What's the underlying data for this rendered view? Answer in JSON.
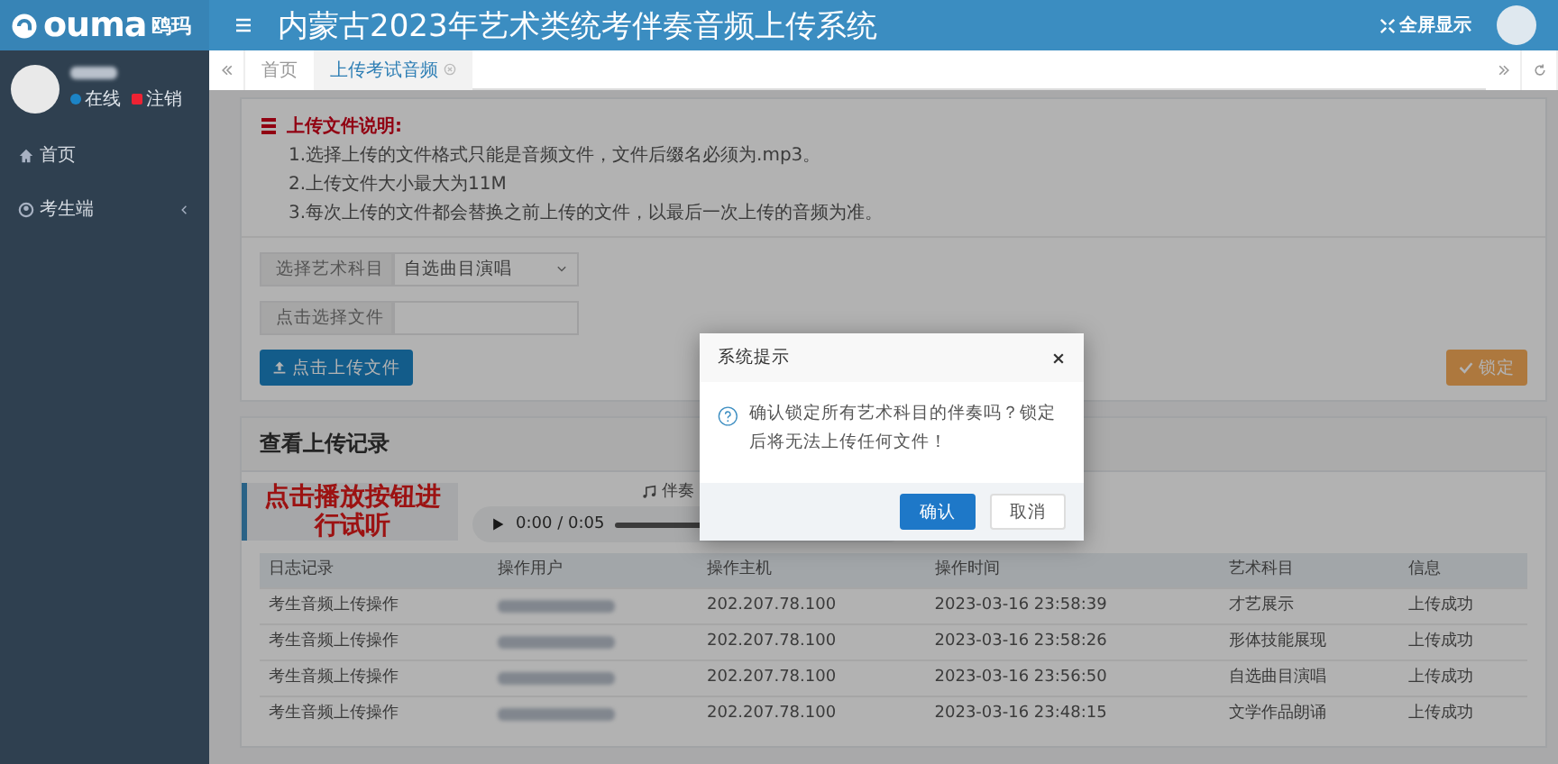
{
  "app": {
    "logo": "ouma",
    "logo_cn": "鸥玛",
    "title": "内蒙古2023年艺术类统考伴奏音频上传系统",
    "fullscreen": "全屏显示"
  },
  "sidebar": {
    "status": "在线",
    "logout": "注销",
    "menu": [
      {
        "label": "首页",
        "kind": "home",
        "expandable": false
      },
      {
        "label": "考生端",
        "kind": "user",
        "expandable": true
      }
    ]
  },
  "tabs": [
    {
      "label": "首页",
      "selected": false,
      "closable": false
    },
    {
      "label": "上传考试音频",
      "selected": true,
      "closable": true
    }
  ],
  "instructions": {
    "title": "上传文件说明:",
    "lines": [
      "1.选择上传的文件格式只能是音频文件，文件后缀名必须为.mp3。",
      "2.上传文件大小最大为11M",
      "3.每次上传的文件都会替换之前上传的文件，以最后一次上传的音频为准。"
    ]
  },
  "form": {
    "subject_label": "选择艺术科目",
    "subject_value": "自选曲目演唱",
    "file_label": "点击选择文件",
    "upload_button": "点击上传文件",
    "lock_button": "锁定"
  },
  "records": {
    "title": "查看上传记录",
    "hint": "点击播放按钮进行试听",
    "player": {
      "time": "0:00 / 0:05",
      "caption": "伴奏"
    },
    "columns": [
      "日志记录",
      "操作用户",
      "操作主机",
      "操作时间",
      "艺术科目",
      "信息"
    ],
    "rows": [
      {
        "log": "考生音频上传操作",
        "host": "202.207.78.100",
        "time": "2023-03-16 23:58:39",
        "subject": "才艺展示",
        "info": "上传成功"
      },
      {
        "log": "考生音频上传操作",
        "host": "202.207.78.100",
        "time": "2023-03-16 23:58:26",
        "subject": "形体技能展现",
        "info": "上传成功"
      },
      {
        "log": "考生音频上传操作",
        "host": "202.207.78.100",
        "time": "2023-03-16 23:56:50",
        "subject": "自选曲目演唱",
        "info": "上传成功"
      },
      {
        "log": "考生音频上传操作",
        "host": "202.207.78.100",
        "time": "2023-03-16 23:48:15",
        "subject": "文学作品朗诵",
        "info": "上传成功"
      }
    ]
  },
  "dialog": {
    "title": "系统提示",
    "message": "确认锁定所有艺术科目的伴奏吗？锁定后将无法上传任何文件！",
    "confirm": "确认",
    "cancel": "取消"
  }
}
